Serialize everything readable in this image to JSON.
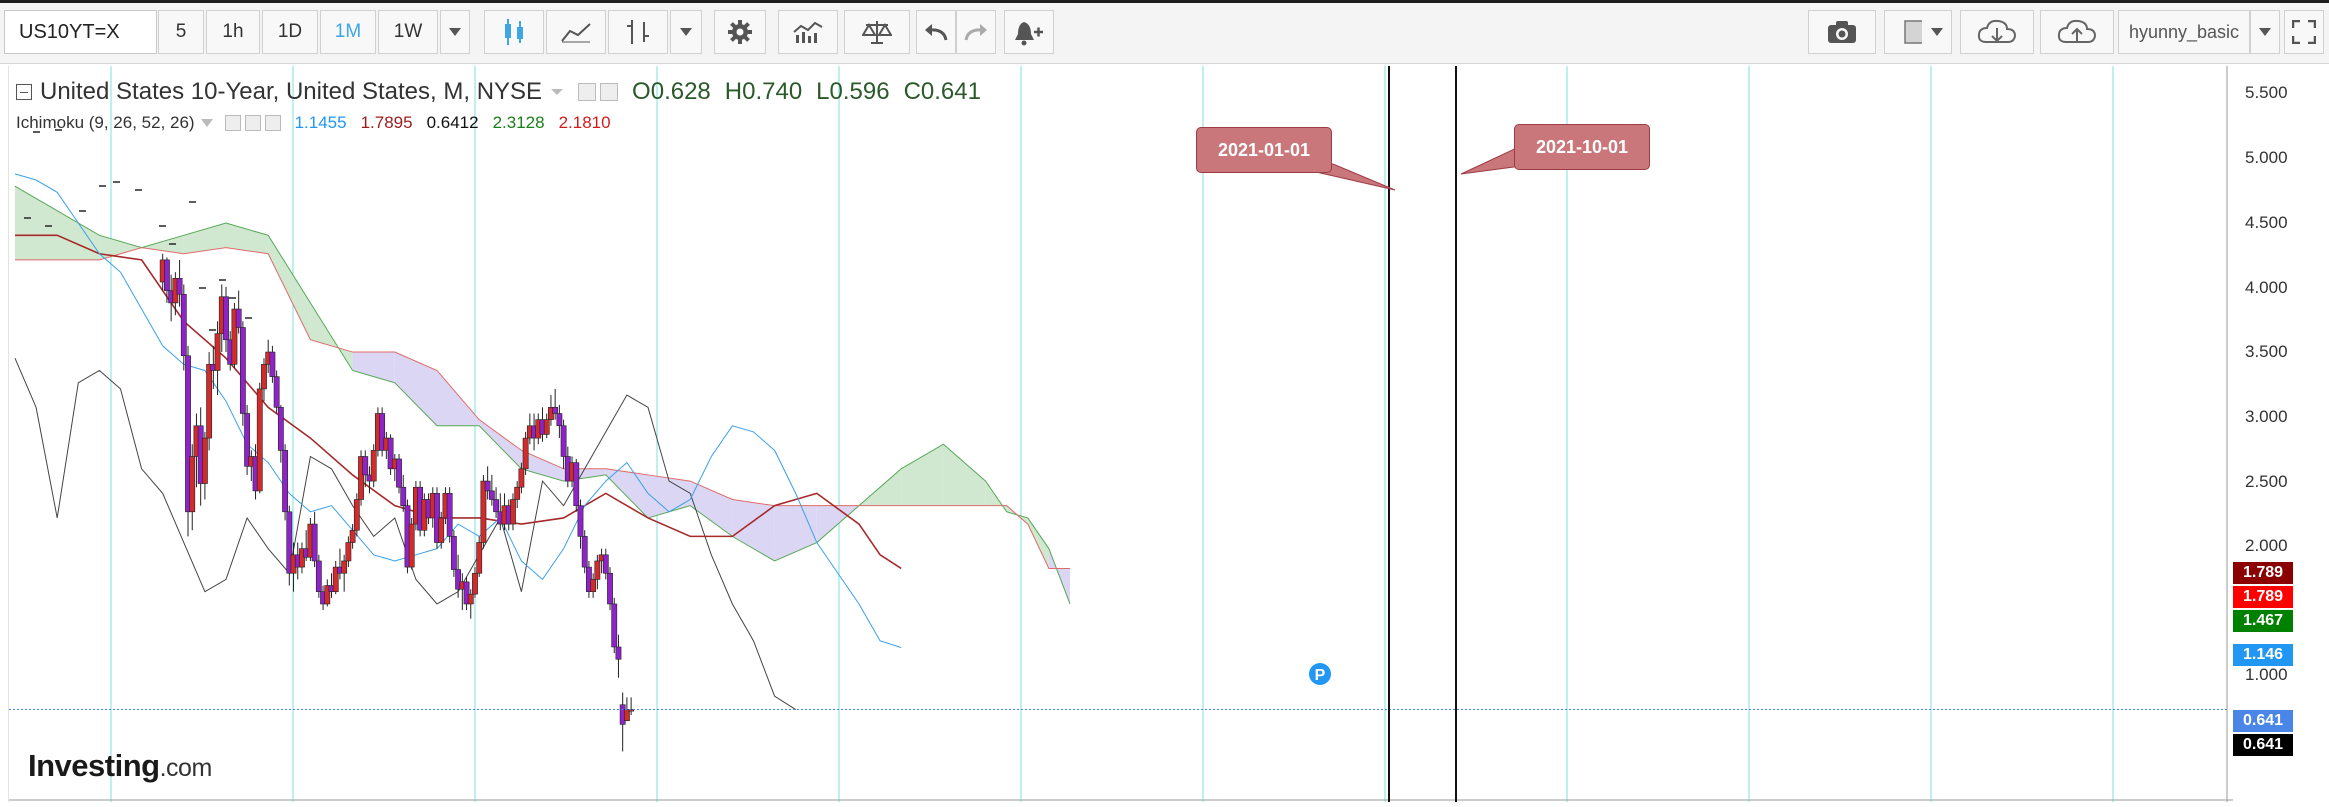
{
  "toolbar": {
    "symbol": "US10YT=X",
    "intervals": [
      "5",
      "1h",
      "1D",
      "1M",
      "1W"
    ],
    "active_interval": "1M",
    "user": "hyunny_basic"
  },
  "legend": {
    "title": "United States 10-Year, United States, M, NYSE",
    "open": "O0.628",
    "high": "H0.740",
    "low": "L0.596",
    "close": "C0.641",
    "indicator": "Ichimoku (9, 26, 52, 26)",
    "indicator_values": [
      {
        "text": "1.1455",
        "color": "#2196f3"
      },
      {
        "text": "1.7895",
        "color": "#9b1c1c"
      },
      {
        "text": "0.6412",
        "color": "#111111"
      },
      {
        "text": "2.3128",
        "color": "#1b7f1b"
      },
      {
        "text": "2.1810",
        "color": "#d11c1c"
      }
    ]
  },
  "annotations": [
    {
      "text": "2021-01-01"
    },
    {
      "text": "2021-10-01"
    }
  ],
  "price_axis": {
    "labels": [
      "5.500",
      "5.000",
      "4.500",
      "4.000",
      "3.500",
      "3.000",
      "2.500",
      "2.000",
      "1.000"
    ],
    "tags": [
      {
        "text": "1.789",
        "color": "#8b0000"
      },
      {
        "text": "1.789",
        "color": "#ff0000"
      },
      {
        "text": "1.467",
        "color": "#008000"
      },
      {
        "text": "1.146",
        "color": "#2196f3"
      },
      {
        "text": "0.641",
        "color": "#4a86e8"
      },
      {
        "text": "0.641",
        "color": "#000000"
      }
    ]
  },
  "branding": {
    "logo_main": "Investing",
    "logo_suffix": ".com"
  },
  "colors": {
    "up": "#d22b2b",
    "down": "#8e24c8",
    "cloud_bull": "#cfe8cf",
    "cloud_bear": "#dcd6f5",
    "grid": "#7ee0e6"
  },
  "chart_data": {
    "type": "candlestick",
    "ylim": [
      0.1,
      5.65
    ],
    "last_close": 0.641,
    "candles": [
      [
        4.12,
        4.35,
        4.05,
        4.3
      ],
      [
        4.3,
        4.32,
        3.95,
        4.05
      ],
      [
        4.05,
        4.18,
        3.8,
        3.95
      ],
      [
        3.95,
        4.2,
        3.85,
        4.15
      ],
      [
        4.15,
        4.3,
        3.92,
        4.02
      ],
      [
        4.02,
        4.1,
        3.4,
        3.52
      ],
      [
        3.52,
        3.6,
        2.05,
        2.25
      ],
      [
        2.25,
        2.8,
        2.1,
        2.7
      ],
      [
        2.7,
        3.05,
        2.45,
        2.95
      ],
      [
        2.95,
        3.1,
        2.3,
        2.48
      ],
      [
        2.48,
        2.9,
        2.35,
        2.85
      ],
      [
        2.85,
        3.55,
        2.75,
        3.45
      ],
      [
        3.45,
        3.6,
        3.25,
        3.4
      ],
      [
        3.4,
        3.8,
        3.2,
        3.7
      ],
      [
        3.7,
        4.1,
        3.55,
        4.0
      ],
      [
        4.0,
        4.08,
        3.55,
        3.65
      ],
      [
        3.65,
        3.72,
        3.4,
        3.45
      ],
      [
        3.45,
        3.95,
        3.42,
        3.9
      ],
      [
        3.9,
        4.05,
        3.7,
        3.75
      ],
      [
        3.75,
        3.8,
        2.95,
        3.05
      ],
      [
        3.05,
        3.12,
        2.55,
        2.62
      ],
      [
        2.62,
        2.75,
        2.5,
        2.7
      ],
      [
        2.7,
        2.8,
        2.35,
        2.42
      ],
      [
        2.42,
        3.3,
        2.4,
        3.25
      ],
      [
        3.25,
        3.5,
        3.15,
        3.45
      ],
      [
        3.45,
        3.65,
        3.38,
        3.55
      ],
      [
        3.55,
        3.6,
        3.3,
        3.35
      ],
      [
        3.35,
        3.4,
        3.05,
        3.1
      ],
      [
        3.1,
        3.12,
        2.65,
        2.75
      ],
      [
        2.75,
        2.8,
        2.18,
        2.25
      ],
      [
        2.25,
        2.3,
        1.65,
        1.75
      ],
      [
        1.75,
        2.0,
        1.6,
        1.9
      ],
      [
        1.9,
        2.0,
        1.7,
        1.8
      ],
      [
        1.8,
        2.0,
        1.75,
        1.95
      ],
      [
        1.95,
        2.1,
        1.85,
        1.88
      ],
      [
        1.88,
        2.2,
        1.85,
        2.15
      ],
      [
        2.15,
        2.25,
        1.8,
        1.85
      ],
      [
        1.85,
        1.9,
        1.55,
        1.6
      ],
      [
        1.6,
        1.65,
        1.45,
        1.5
      ],
      [
        1.5,
        1.7,
        1.48,
        1.65
      ],
      [
        1.65,
        1.75,
        1.55,
        1.6
      ],
      [
        1.6,
        1.85,
        1.58,
        1.8
      ],
      [
        1.8,
        1.95,
        1.7,
        1.75
      ],
      [
        1.75,
        1.9,
        1.6,
        1.85
      ],
      [
        1.85,
        2.05,
        1.8,
        2.0
      ],
      [
        2.0,
        2.15,
        1.95,
        2.1
      ],
      [
        2.1,
        2.4,
        2.05,
        2.35
      ],
      [
        2.35,
        2.75,
        2.3,
        2.7
      ],
      [
        2.7,
        2.75,
        2.45,
        2.55
      ],
      [
        2.55,
        2.62,
        2.4,
        2.5
      ],
      [
        2.5,
        2.8,
        2.45,
        2.75
      ],
      [
        2.75,
        3.1,
        2.7,
        3.05
      ],
      [
        3.05,
        3.1,
        2.7,
        2.75
      ],
      [
        2.75,
        2.9,
        2.68,
        2.85
      ],
      [
        2.85,
        2.88,
        2.55,
        2.6
      ],
      [
        2.6,
        2.72,
        2.5,
        2.68
      ],
      [
        2.68,
        2.72,
        2.4,
        2.45
      ],
      [
        2.45,
        2.55,
        2.25,
        2.3
      ],
      [
        2.3,
        2.35,
        1.75,
        1.8
      ],
      [
        1.8,
        2.2,
        1.78,
        2.15
      ],
      [
        2.15,
        2.5,
        2.1,
        2.45
      ],
      [
        2.45,
        2.5,
        2.05,
        2.1
      ],
      [
        2.1,
        2.4,
        2.05,
        2.35
      ],
      [
        2.35,
        2.4,
        2.15,
        2.2
      ],
      [
        2.2,
        2.45,
        2.12,
        2.4
      ],
      [
        2.4,
        2.45,
        1.95,
        2.0
      ],
      [
        2.0,
        2.25,
        1.95,
        2.2
      ],
      [
        2.2,
        2.45,
        2.15,
        2.4
      ],
      [
        2.4,
        2.45,
        2.0,
        2.05
      ],
      [
        2.05,
        2.1,
        1.72,
        1.78
      ],
      [
        1.78,
        1.9,
        1.55,
        1.62
      ],
      [
        1.62,
        1.75,
        1.45,
        1.68
      ],
      [
        1.68,
        1.72,
        1.45,
        1.5
      ],
      [
        1.5,
        1.62,
        1.38,
        1.58
      ],
      [
        1.58,
        1.8,
        1.55,
        1.75
      ],
      [
        1.75,
        2.05,
        1.72,
        2.0
      ],
      [
        2.0,
        2.55,
        1.95,
        2.5
      ],
      [
        2.5,
        2.62,
        2.35,
        2.42
      ],
      [
        2.42,
        2.55,
        2.3,
        2.35
      ],
      [
        2.35,
        2.45,
        2.2,
        2.25
      ],
      [
        2.25,
        2.4,
        2.1,
        2.15
      ],
      [
        2.15,
        2.4,
        2.1,
        2.3
      ],
      [
        2.3,
        2.35,
        2.1,
        2.15
      ],
      [
        2.15,
        2.4,
        2.1,
        2.35
      ],
      [
        2.35,
        2.5,
        2.28,
        2.45
      ],
      [
        2.45,
        2.65,
        2.4,
        2.6
      ],
      [
        2.6,
        2.9,
        2.55,
        2.85
      ],
      [
        2.85,
        3.05,
        2.8,
        2.95
      ],
      [
        2.95,
        3.05,
        2.75,
        2.85
      ],
      [
        2.85,
        3.05,
        2.8,
        3.0
      ],
      [
        3.0,
        3.1,
        2.82,
        2.88
      ],
      [
        2.88,
        3.05,
        2.85,
        3.0
      ],
      [
        3.0,
        3.2,
        2.95,
        3.1
      ],
      [
        3.1,
        3.25,
        3.0,
        3.05
      ],
      [
        3.05,
        3.12,
        2.85,
        2.95
      ],
      [
        2.95,
        3.0,
        2.6,
        2.7
      ],
      [
        2.7,
        2.78,
        2.45,
        2.5
      ],
      [
        2.5,
        2.7,
        2.45,
        2.65
      ],
      [
        2.65,
        2.68,
        2.25,
        2.3
      ],
      [
        2.3,
        2.35,
        1.95,
        2.05
      ],
      [
        2.05,
        2.1,
        1.75,
        1.8
      ],
      [
        1.8,
        1.85,
        1.55,
        1.6
      ],
      [
        1.6,
        1.75,
        1.55,
        1.7
      ],
      [
        1.7,
        1.9,
        1.62,
        1.85
      ],
      [
        1.85,
        1.95,
        1.75,
        1.9
      ],
      [
        1.9,
        1.95,
        1.7,
        1.75
      ],
      [
        1.75,
        1.8,
        1.45,
        1.5
      ],
      [
        1.5,
        1.55,
        1.1,
        1.15
      ],
      [
        1.15,
        1.25,
        0.9,
        1.05
      ],
      [
        0.68,
        0.78,
        0.3,
        0.52
      ],
      [
        0.55,
        0.74,
        0.55,
        0.64
      ],
      [
        0.628,
        0.74,
        0.596,
        0.641
      ]
    ],
    "tenkan": [
      [
        0,
        5.0
      ],
      [
        5,
        4.95
      ],
      [
        10,
        4.85
      ],
      [
        15,
        4.6
      ],
      [
        20,
        4.35
      ],
      [
        25,
        4.2
      ],
      [
        30,
        3.9
      ],
      [
        35,
        3.6
      ],
      [
        40,
        3.45
      ],
      [
        45,
        3.4
      ],
      [
        50,
        3.15
      ],
      [
        55,
        2.8
      ],
      [
        60,
        2.65
      ],
      [
        65,
        2.4
      ],
      [
        70,
        2.25
      ],
      [
        75,
        2.3
      ],
      [
        80,
        2.1
      ],
      [
        85,
        1.9
      ],
      [
        90,
        1.85
      ],
      [
        95,
        1.9
      ],
      [
        100,
        1.95
      ],
      [
        105,
        2.15
      ],
      [
        110,
        2.05
      ],
      [
        115,
        2.2
      ],
      [
        120,
        1.85
      ],
      [
        125,
        1.7
      ],
      [
        130,
        1.95
      ],
      [
        135,
        2.3
      ],
      [
        140,
        2.5
      ],
      [
        145,
        2.65
      ],
      [
        150,
        2.4
      ],
      [
        155,
        2.25
      ],
      [
        160,
        2.35
      ],
      [
        165,
        2.7
      ],
      [
        170,
        2.95
      ],
      [
        175,
        2.9
      ],
      [
        180,
        2.75
      ],
      [
        185,
        2.4
      ],
      [
        190,
        2.0
      ],
      [
        195,
        1.75
      ],
      [
        200,
        1.5
      ],
      [
        205,
        1.2
      ],
      [
        210,
        1.146
      ]
    ],
    "kijun": [
      [
        0,
        4.5
      ],
      [
        10,
        4.5
      ],
      [
        20,
        4.35
      ],
      [
        30,
        4.3
      ],
      [
        40,
        3.8
      ],
      [
        50,
        3.5
      ],
      [
        60,
        3.1
      ],
      [
        70,
        2.85
      ],
      [
        80,
        2.55
      ],
      [
        90,
        2.3
      ],
      [
        100,
        2.2
      ],
      [
        110,
        2.2
      ],
      [
        120,
        2.15
      ],
      [
        130,
        2.2
      ],
      [
        140,
        2.4
      ],
      [
        150,
        2.2
      ],
      [
        160,
        2.05
      ],
      [
        170,
        2.05
      ],
      [
        180,
        2.3
      ],
      [
        190,
        2.4
      ],
      [
        200,
        2.15
      ],
      [
        205,
        1.9
      ],
      [
        210,
        1.789
      ]
    ],
    "chikou": [
      [
        0,
        3.5
      ],
      [
        5,
        3.1
      ],
      [
        10,
        2.2
      ],
      [
        15,
        3.3
      ],
      [
        20,
        3.4
      ],
      [
        25,
        3.25
      ],
      [
        30,
        2.6
      ],
      [
        35,
        2.4
      ],
      [
        40,
        2.0
      ],
      [
        45,
        1.6
      ],
      [
        50,
        1.7
      ],
      [
        55,
        2.2
      ],
      [
        60,
        1.95
      ],
      [
        65,
        1.75
      ],
      [
        70,
        2.7
      ],
      [
        75,
        2.6
      ],
      [
        80,
        2.3
      ],
      [
        85,
        2.05
      ],
      [
        90,
        2.2
      ],
      [
        95,
        1.7
      ],
      [
        100,
        1.5
      ],
      [
        105,
        1.6
      ],
      [
        110,
        1.9
      ],
      [
        115,
        2.2
      ],
      [
        120,
        1.6
      ],
      [
        125,
        2.5
      ],
      [
        130,
        2.3
      ],
      [
        135,
        2.6
      ],
      [
        140,
        2.9
      ],
      [
        145,
        3.2
      ],
      [
        150,
        3.1
      ],
      [
        155,
        2.5
      ],
      [
        160,
        2.4
      ],
      [
        165,
        1.9
      ],
      [
        170,
        1.5
      ],
      [
        175,
        1.2
      ],
      [
        180,
        0.75
      ],
      [
        185,
        0.641
      ]
    ],
    "span_a": [
      [
        0,
        4.9
      ],
      [
        20,
        4.5
      ],
      [
        30,
        4.4
      ],
      [
        40,
        4.5
      ],
      [
        50,
        4.6
      ],
      [
        60,
        4.5
      ],
      [
        70,
        3.95
      ],
      [
        80,
        3.4
      ],
      [
        90,
        3.3
      ],
      [
        100,
        2.95
      ],
      [
        110,
        2.95
      ],
      [
        120,
        2.6
      ],
      [
        130,
        2.5
      ],
      [
        140,
        2.55
      ],
      [
        150,
        2.2
      ],
      [
        160,
        2.3
      ],
      [
        170,
        2.05
      ],
      [
        180,
        1.85
      ],
      [
        190,
        2.0
      ],
      [
        200,
        2.3
      ],
      [
        210,
        2.6
      ],
      [
        220,
        2.8
      ],
      [
        230,
        2.5
      ],
      [
        235,
        2.25
      ],
      [
        240,
        2.2
      ],
      [
        245,
        1.95
      ],
      [
        250,
        1.5
      ]
    ],
    "span_b": [
      [
        0,
        4.3
      ],
      [
        20,
        4.3
      ],
      [
        30,
        4.4
      ],
      [
        40,
        4.35
      ],
      [
        50,
        4.4
      ],
      [
        60,
        4.35
      ],
      [
        70,
        3.65
      ],
      [
        80,
        3.55
      ],
      [
        90,
        3.55
      ],
      [
        100,
        3.4
      ],
      [
        110,
        3.0
      ],
      [
        120,
        2.75
      ],
      [
        130,
        2.6
      ],
      [
        140,
        2.6
      ],
      [
        150,
        2.55
      ],
      [
        160,
        2.5
      ],
      [
        170,
        2.35
      ],
      [
        180,
        2.3
      ],
      [
        190,
        2.3
      ],
      [
        200,
        2.3
      ],
      [
        210,
        2.3
      ],
      [
        220,
        2.3
      ],
      [
        230,
        2.3
      ],
      [
        235,
        2.3
      ],
      [
        240,
        2.15
      ],
      [
        245,
        1.789
      ],
      [
        250,
        1.789
      ]
    ],
    "event_lines": [
      "2021-01-01",
      "2021-10-01"
    ]
  }
}
